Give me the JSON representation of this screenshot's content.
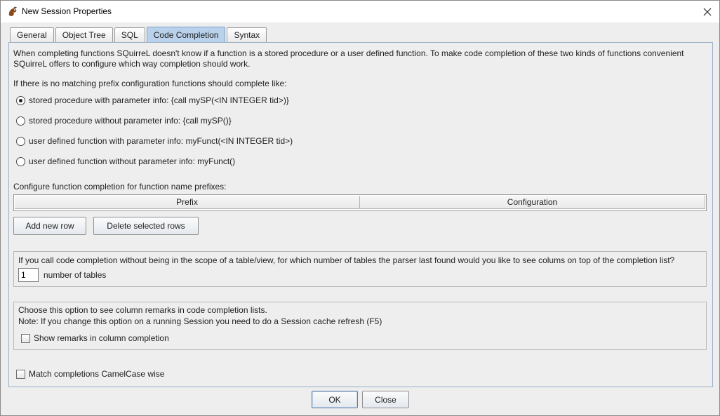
{
  "window": {
    "title": "New Session Properties",
    "icon": "squirrel-app-icon"
  },
  "tabs": [
    {
      "label": "General",
      "active": false
    },
    {
      "label": "Object Tree",
      "active": false
    },
    {
      "label": "SQL",
      "active": false
    },
    {
      "label": "Code Completion",
      "active": true
    },
    {
      "label": "Syntax",
      "active": false
    }
  ],
  "code_completion": {
    "intro": "When completing functions SQuirreL doesn't know if a function is a stored procedure or a user defined function. To make code completion of these two kinds of functions convenient SQuirreL offers to configure which way completion should work.",
    "prefix_heading": "If there is no matching prefix configuration functions should complete like:",
    "options": [
      {
        "label": "stored procedure with parameter info: {call mySP(<IN INTEGER tid>)}",
        "checked": true
      },
      {
        "label": "stored procedure without parameter info: {call mySP()}",
        "checked": false
      },
      {
        "label": "user defined function with parameter info: myFunct(<IN INTEGER tid>)",
        "checked": false
      },
      {
        "label": "user defined function without parameter info: myFunct()",
        "checked": false
      }
    ],
    "prefix_table_heading": "Configure function completion for function name prefixes:",
    "table_columns": [
      "Prefix",
      "Configuration"
    ],
    "add_row_label": "Add new row",
    "delete_rows_label": "Delete selected rows",
    "tables_question": "If you call code completion without being in the scope of a table/view, for which number of tables the parser last found would you like to see colums on top of the completion list?",
    "tables_value": "1",
    "tables_unit": "number of tables",
    "remarks_line1": "Choose this option to see column remarks in code completion lists.",
    "remarks_line2": "Note: If you change this option on a running Session you need to do a Session cache refresh (F5)",
    "show_remarks_label": "Show remarks in column completion",
    "show_remarks_checked": false,
    "camelcase_label": "Match completions CamelCase wise",
    "camelcase_checked": false
  },
  "footer": {
    "ok_label": "OK",
    "close_label": "Close"
  },
  "colors": {
    "active_tab": "#b9d1ea",
    "panel_border": "#9ab0c8"
  }
}
